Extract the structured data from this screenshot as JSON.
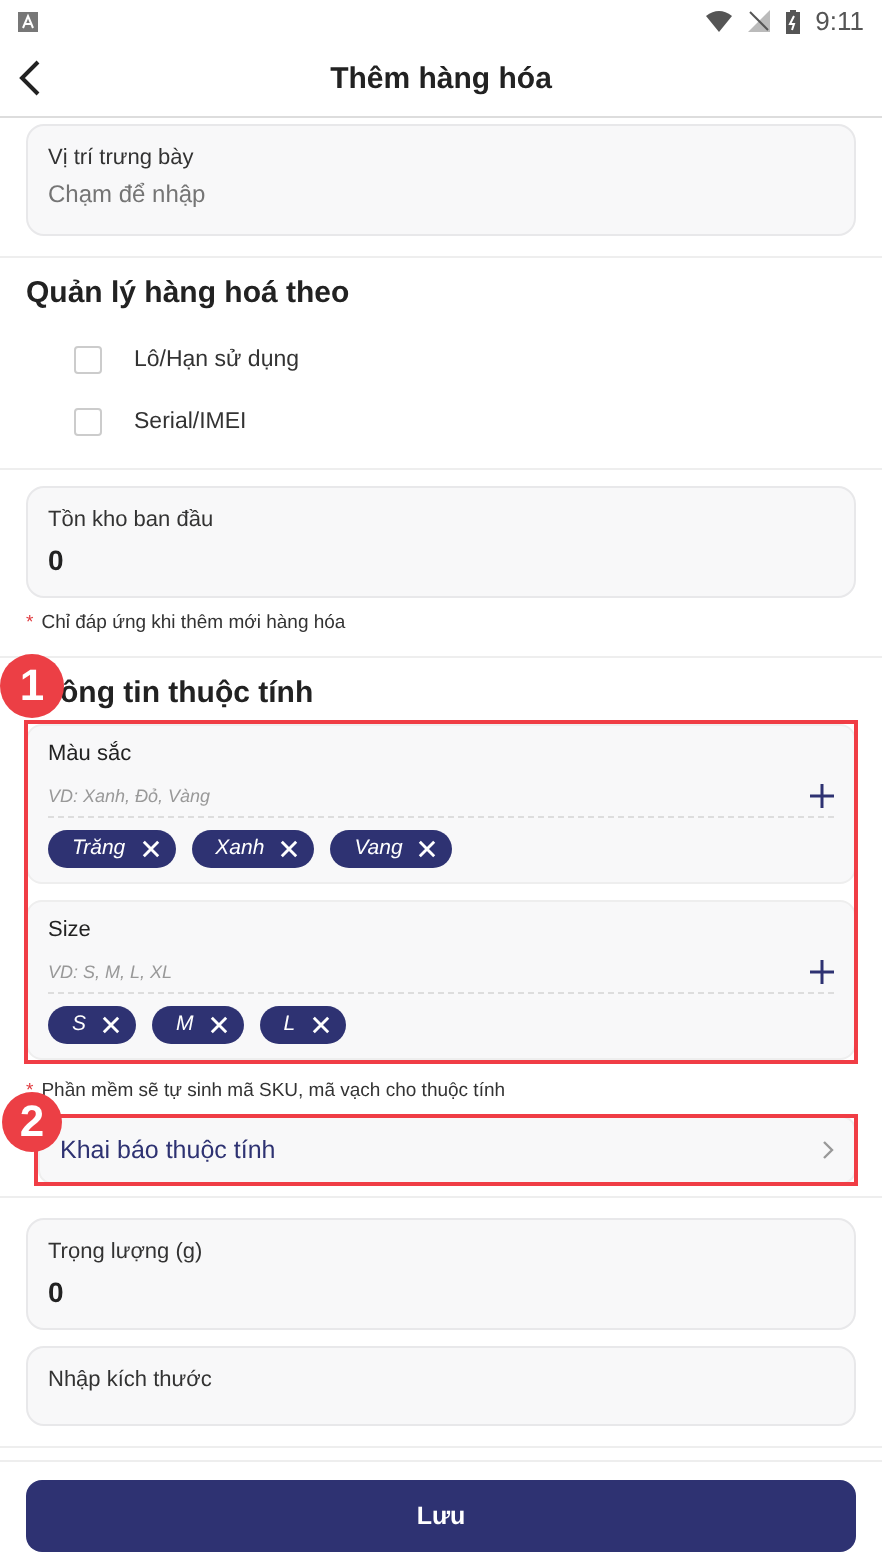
{
  "status_bar": {
    "time": "9:11"
  },
  "header": {
    "title": "Thêm hàng hóa"
  },
  "display_location": {
    "label": "Vị trí trưng bày",
    "placeholder": "Chạm để nhập"
  },
  "manage_by": {
    "title": "Quản lý hàng hoá theo",
    "options": [
      {
        "label": "Lô/Hạn sử dụng",
        "checked": false
      },
      {
        "label": "Serial/IMEI",
        "checked": false
      }
    ]
  },
  "initial_stock": {
    "label": "Tồn kho ban đầu",
    "value": "0",
    "note_mark": "*",
    "note": "Chỉ đáp ứng khi thêm mới hàng hóa"
  },
  "attributes": {
    "title": "ông tin thuộc tính",
    "groups": [
      {
        "name": "Màu sắc",
        "placeholder": "VD: Xanh, Đỏ, Vàng",
        "tags": [
          "Trăng",
          "Xanh",
          "Vang"
        ]
      },
      {
        "name": "Size",
        "placeholder": "VD: S, M, L, XL",
        "tags": [
          "S",
          "M",
          "L"
        ]
      }
    ],
    "note_mark": "*",
    "note": "Phần mềm sẽ tự sinh mã SKU, mã vạch cho thuộc tính"
  },
  "declare_link": {
    "label": "Khai báo thuộc tính"
  },
  "weight": {
    "label": "Trọng lượng (g)",
    "value": "0"
  },
  "dimensions": {
    "label": "Nhập kích thước"
  },
  "annotations": [
    {
      "number": "1"
    },
    {
      "number": "2"
    }
  ],
  "save_button": "Lưu"
}
